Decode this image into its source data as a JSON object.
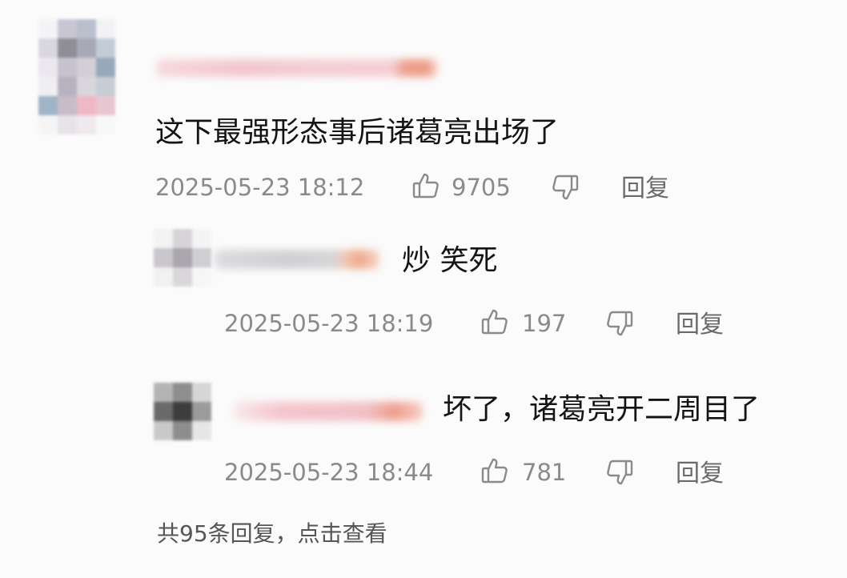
{
  "main_comment": {
    "avatar_colors": [
      "#f4f4f6",
      "#c9c6d3",
      "#b9bfcc",
      "#f2f2f4",
      "#d9d6e0",
      "#8f8e97",
      "#a7a9b6",
      "#c3ccd6",
      "#ebe7ee",
      "#c8c2cf",
      "#d2cfd8",
      "#96a9bb",
      "#f0eef2",
      "#b6b2c0",
      "#d9d5dd",
      "#c7cdd5",
      "#9fb4c6",
      "#c7bdc8",
      "#f0b8c5",
      "#e8c7d1",
      "#f5f5f6",
      "#e7e3e8",
      "#efe9ee",
      "#f8f8f8"
    ],
    "text": "这下最强形态事后诸葛亮出场了",
    "timestamp": "2025-05-23 18:12",
    "like_count": "9705",
    "reply_label": "回复"
  },
  "replies": [
    {
      "avatar_colors": [
        "#f3f3f3",
        "#d7d4d8",
        "#f4f4f4",
        "#c9c6cc",
        "#a9a6ad",
        "#d0ced3",
        "#f1f1f1",
        "#d9d7da",
        "#f6f6f6"
      ],
      "text": "炒 笑死",
      "timestamp": "2025-05-23 18:19",
      "like_count": "197",
      "reply_label": "回复"
    },
    {
      "avatar_colors": [
        "#b4b4b4",
        "#8e8e8e",
        "#d6d6d6",
        "#6a6a6a",
        "#3d3d3d",
        "#9b9b9b",
        "#c9c9c9",
        "#8d8d8d",
        "#e6e6e6"
      ],
      "text": "坏了，诸葛亮开二周目了",
      "timestamp": "2025-05-23 18:44",
      "like_count": "781",
      "reply_label": "回复"
    }
  ],
  "view_all_replies": "共95条回复，点击查看",
  "icons": {
    "like": "thumbs-up-icon",
    "dislike": "thumbs-down-icon"
  },
  "colors": {
    "background": "#fbfbfb",
    "text": "#141414",
    "meta": "#8a8a8a"
  }
}
